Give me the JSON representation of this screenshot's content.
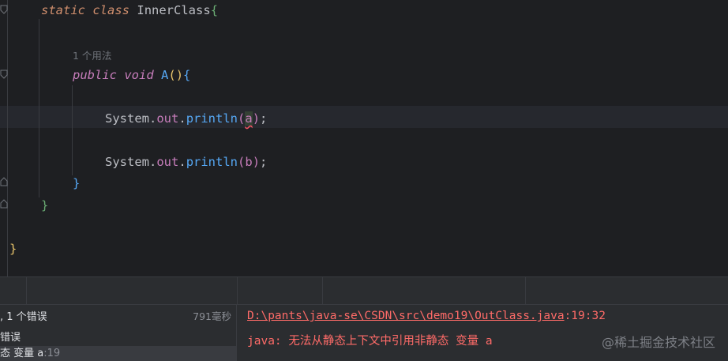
{
  "editor": {
    "line1": {
      "kw1": "static",
      "kw2": "class",
      "name": "InnerClass",
      "brace": "{"
    },
    "usage_hint": "1 个用法",
    "line2": {
      "kw1": "public",
      "kw2": "void",
      "name": "A",
      "paren": "()",
      "brace": "{"
    },
    "line3": {
      "obj": "System",
      "dot1": ".",
      "field": "out",
      "dot2": ".",
      "method": "println",
      "open": "(",
      "arg": "a",
      "close": ")",
      "semi": ";"
    },
    "line4": {
      "obj": "System",
      "dot1": ".",
      "field": "out",
      "dot2": ".",
      "method": "println",
      "open": "(",
      "arg": "b",
      "close": ")",
      "semi": ";"
    },
    "close_method": "}",
    "close_inner": "}",
    "close_outer": "}"
  },
  "problems": {
    "summary": ", 1 个错误",
    "duration": "791毫秒",
    "category": "错误",
    "item_prefix": "态 变量 a",
    "item_pos": ":19"
  },
  "output": {
    "path": "D:\\pants\\java-se\\CSDN\\src\\demo19\\OutClass.java",
    "position": ":19:32",
    "message": "java: 无法从静态上下文中引用非静态 变量 a"
  },
  "watermark": "@稀土掘金技术社区"
}
